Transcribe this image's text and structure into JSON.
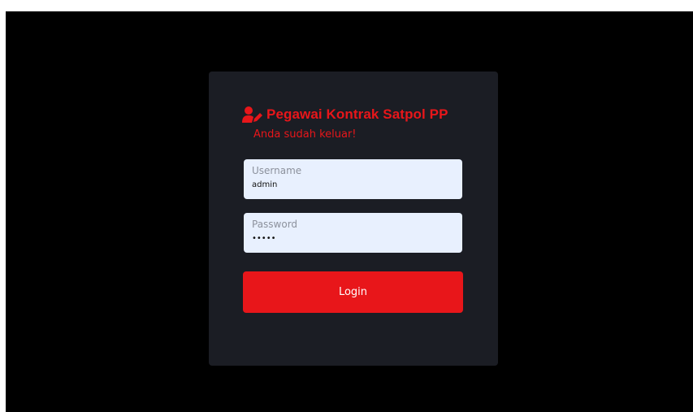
{
  "login": {
    "title": "Pegawai Kontrak Satpol PP",
    "title_icon": "user-edit-icon",
    "message": "Anda sudah keluar!",
    "username": {
      "label": "Username",
      "value": "admin"
    },
    "password": {
      "label": "Password",
      "value": "admin"
    },
    "button_label": "Login"
  },
  "colors": {
    "background": "#000000",
    "card": "#1b1d24",
    "accent": "#e8161a",
    "input_bg": "#e8f0fe",
    "input_label": "#8c919c"
  }
}
